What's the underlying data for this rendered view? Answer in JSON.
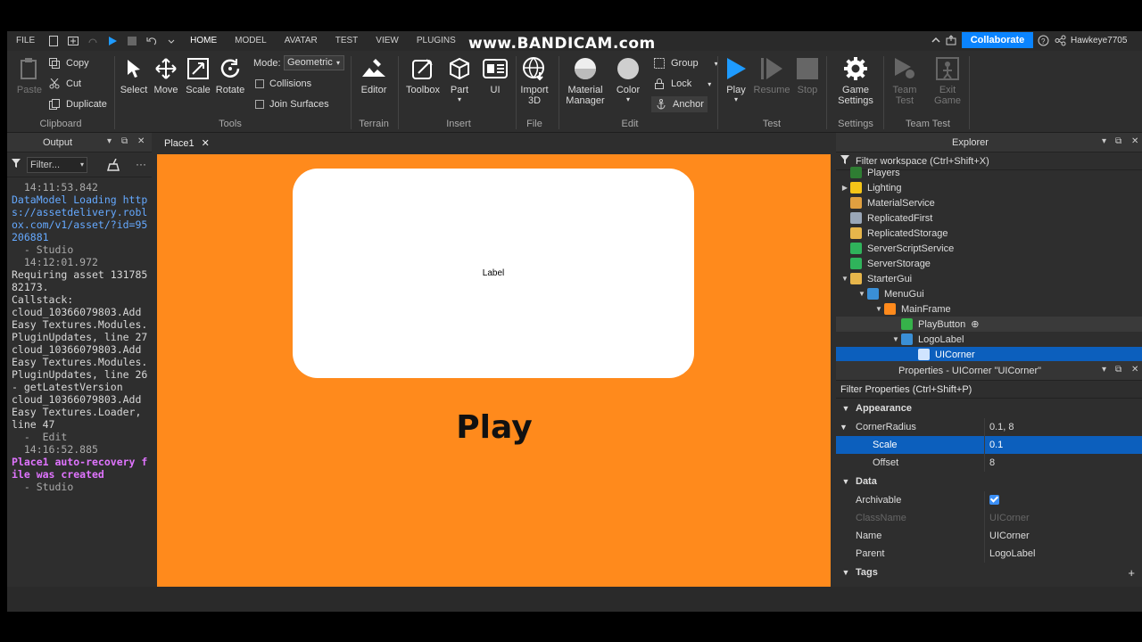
{
  "watermark": "www.BANDICAM.com",
  "menu": {
    "tabs": [
      "FILE",
      "HOME",
      "MODEL",
      "AVATAR",
      "TEST",
      "VIEW",
      "PLUGINS"
    ],
    "active": "HOME",
    "collaborate": "Collaborate",
    "username": "Hawkeye7705"
  },
  "ribbon": {
    "clipboard": {
      "paste": "Paste",
      "copy": "Copy",
      "cut": "Cut",
      "duplicate": "Duplicate",
      "label": "Clipboard"
    },
    "tools": {
      "select": "Select",
      "move": "Move",
      "scale": "Scale",
      "rotate": "Rotate",
      "mode_label": "Mode:",
      "mode_value": "Geometric",
      "collisions": "Collisions",
      "join": "Join Surfaces",
      "label": "Tools"
    },
    "terrain": {
      "editor": "Editor",
      "label": "Terrain"
    },
    "insert": {
      "toolbox": "Toolbox",
      "part": "Part",
      "ui": "UI",
      "label": "Insert"
    },
    "file": {
      "import_l1": "Import",
      "import_l2": "3D",
      "label": "File"
    },
    "edit": {
      "material_l1": "Material",
      "material_l2": "Manager",
      "color": "Color",
      "group": "Group",
      "lock": "Lock",
      "anchor": "Anchor",
      "label": "Edit"
    },
    "test": {
      "play": "Play",
      "resume": "Resume",
      "stop": "Stop",
      "label": "Test"
    },
    "settings": {
      "game_l1": "Game",
      "game_l2": "Settings",
      "label": "Settings"
    },
    "teamtest": {
      "team_l1": "Team",
      "team_l2": "Test",
      "exit_l1": "Exit",
      "exit_l2": "Game",
      "label": "Team Test"
    }
  },
  "output": {
    "title": "Output",
    "filter": "Filter...",
    "log": [
      {
        "text": "  14:11:53.842",
        "kind": "dim"
      },
      {
        "text": "DataModel Loading https://assetdelivery.roblox.com/v1/asset/?id=95206881",
        "kind": "info"
      },
      {
        "text": "  - Studio",
        "kind": "dim"
      },
      {
        "text": "  14:12:01.972",
        "kind": "dim"
      },
      {
        "text": "Requiring asset 13178582173.\nCallstack:\ncloud_10366079803.Add Easy Textures.Modules.PluginUpdates, line 27\ncloud_10366079803.Add Easy Textures.Modules.PluginUpdates, line 26 - getLatestVersion\ncloud_10366079803.Add Easy Textures.Loader, line 47",
        "kind": "normal"
      },
      {
        "text": "  -  Edit",
        "kind": "dim"
      },
      {
        "text": "  14:16:52.885",
        "kind": "dim"
      },
      {
        "text": "Place1 auto-recovery file was created",
        "kind": "warn"
      },
      {
        "text": "  - Studio",
        "kind": "dim"
      }
    ]
  },
  "document": {
    "tab": "Place1",
    "label_text": "Label",
    "play_text": "Play",
    "bg_color": "#ff8a1c"
  },
  "explorer": {
    "title": "Explorer",
    "filter": "Filter workspace (Ctrl+Shift+X)",
    "items": [
      {
        "label": "Players",
        "depth": 0,
        "arrow": "",
        "color": "#2e7d32",
        "state": ""
      },
      {
        "label": "Lighting",
        "depth": 0,
        "arrow": "right",
        "color": "#f5c518",
        "state": ""
      },
      {
        "label": "MaterialService",
        "depth": 0,
        "arrow": "",
        "color": "#e0a040",
        "state": ""
      },
      {
        "label": "ReplicatedFirst",
        "depth": 0,
        "arrow": "",
        "color": "#9aa7b8",
        "state": ""
      },
      {
        "label": "ReplicatedStorage",
        "depth": 0,
        "arrow": "",
        "color": "#e7b64b",
        "state": ""
      },
      {
        "label": "ServerScriptService",
        "depth": 0,
        "arrow": "",
        "color": "#2fb35b",
        "state": ""
      },
      {
        "label": "ServerStorage",
        "depth": 0,
        "arrow": "",
        "color": "#2fb35b",
        "state": ""
      },
      {
        "label": "StarterGui",
        "depth": 0,
        "arrow": "down",
        "color": "#e7b64b",
        "state": ""
      },
      {
        "label": "MenuGui",
        "depth": 1,
        "arrow": "down",
        "color": "#3a8fd6",
        "state": ""
      },
      {
        "label": "MainFrame",
        "depth": 2,
        "arrow": "down",
        "color": "#ff8a1c",
        "state": ""
      },
      {
        "label": "PlayButton",
        "depth": 3,
        "arrow": "",
        "color": "#36b24a",
        "state": "hov"
      },
      {
        "label": "LogoLabel",
        "depth": 3,
        "arrow": "down",
        "color": "#3a8fd6",
        "state": ""
      },
      {
        "label": "UICorner",
        "depth": 4,
        "arrow": "",
        "color": "#d0e4ff",
        "state": "sel"
      }
    ]
  },
  "properties": {
    "title": "Properties - UICorner \"UICorner\"",
    "filter": "Filter Properties (Ctrl+Shift+P)",
    "sections": {
      "appearance": "Appearance",
      "data": "Data",
      "tags": "Tags"
    },
    "corner_radius": {
      "name": "CornerRadius",
      "value": "0.1, 8"
    },
    "scale": {
      "name": "Scale",
      "value": "0.1"
    },
    "offset": {
      "name": "Offset",
      "value": "8"
    },
    "archivable": {
      "name": "Archivable",
      "checked": true
    },
    "classname": {
      "name": "ClassName",
      "value": "UICorner"
    },
    "name": {
      "name": "Name",
      "value": "UICorner"
    },
    "parent": {
      "name": "Parent",
      "value": "LogoLabel"
    }
  }
}
